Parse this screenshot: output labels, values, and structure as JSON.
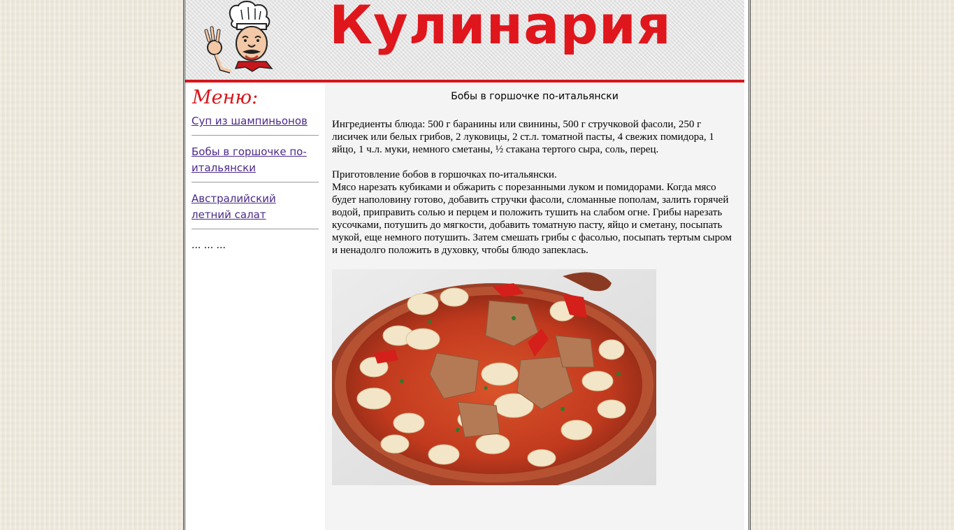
{
  "header": {
    "site_title": "Кулинария",
    "logo_icon": "chef-mascot-icon"
  },
  "sidebar": {
    "heading": "Меню:",
    "items": [
      {
        "label": "Суп из шампиньонов"
      },
      {
        "label": "Бобы в горшочке по-итальянски"
      },
      {
        "label": "Австралийский летний салат"
      }
    ],
    "more": "... ... ..."
  },
  "article": {
    "title": "Бобы в горшочке по-итальянски",
    "ingredients": "Ингредиенты блюда: 500 г баранины или свинины, 500 г стручковой фасоли, 250 г лисичек или белых грибов, 2 луковицы, 2 ст.л. томатной пасты, 4 свежих помидора, 1 яйцо, 1 ч.л. муки, немного сметаны, ½ стакана тертого сыра, соль, перец.",
    "preparation_title": "Приготовление бобов в горшочках по-итальянски.",
    "preparation_text": "Мясо нарезать кубиками и обжарить с порезанными луком и помидорами. Когда мясо будет наполовину готово, добавить стручки фасоли, сломанные пополам, залить горячей водой, приправить солью и перцем и положить тушить на слабом огне. Грибы нарезать кусочками, потушить до мягкости, добавить томатную пасту, яйцо и сметану, посыпать мукой, еще немного потушить. Затем смешать грибы с фасолью, посыпать тертым сыром и ненадолго положить в духовку, чтобы блюдо запеклась.",
    "photo_icon": "bean-stew-photo"
  },
  "colors": {
    "brand_red": "#e0161d",
    "link": "#4b2a8a",
    "content_bg": "#f4f4f4"
  }
}
